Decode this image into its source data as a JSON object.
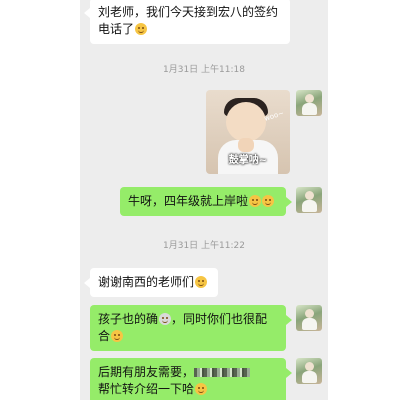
{
  "messages": [
    {
      "type": "in",
      "text": "刘老师，我们今天接到宏八的签约电话了",
      "emoji": "grin"
    },
    {
      "type": "timestamp",
      "text": "1月31日 上午11:18"
    },
    {
      "type": "out_sticker",
      "sticker_caption": "鼓掌呐~",
      "sticker_small_text": "woo~"
    },
    {
      "type": "out",
      "text": "牛呀，四年级就上岸啦",
      "emoji": "grin grin"
    },
    {
      "type": "timestamp",
      "text": "1月31日 上午11:22"
    },
    {
      "type": "in",
      "text": "谢谢南西的老师们",
      "emoji": "grin"
    },
    {
      "type": "out",
      "text_a": "孩子也的确",
      "text_b": "，同时你们也很配合",
      "emoji": "grin"
    },
    {
      "type": "out",
      "text_a": "后期有朋友需要，",
      "text_b": "帮忙转介绍一下哈",
      "emoji": "grin"
    }
  ]
}
